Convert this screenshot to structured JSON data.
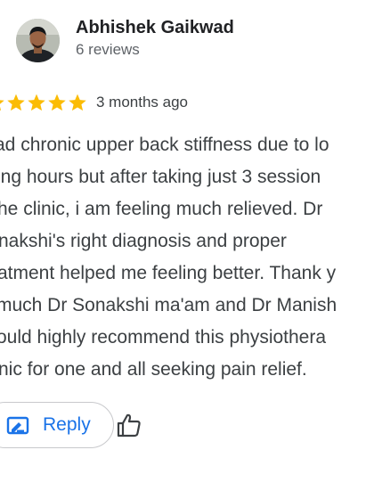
{
  "reviewer": {
    "name": "Abhishek Gaikwad",
    "meta": "6 reviews"
  },
  "rating": {
    "stars": 5,
    "date": "3 months ago"
  },
  "review": {
    "lines": [
      "ad chronic upper back stiffness due to lo",
      "ing hours but after taking just 3 session",
      "he clinic, i am feeling much relieved. Dr",
      "nakshi's right diagnosis and proper",
      "atment helped me feeling better. Thank y",
      "much Dr Sonakshi ma'am and Dr Manish",
      "ould highly recommend this physiothera",
      "nic for one and all seeking pain relief."
    ]
  },
  "actions": {
    "reply_label": "Reply"
  },
  "colors": {
    "star": "#fbbc04",
    "accent": "#1a73e8",
    "text": "#3c4043"
  }
}
